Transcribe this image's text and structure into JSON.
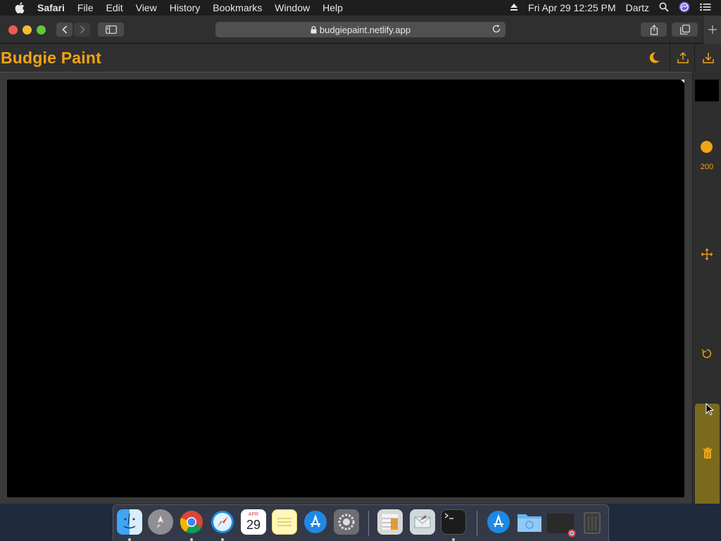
{
  "menubar": {
    "app_name": "Safari",
    "items": [
      "File",
      "Edit",
      "View",
      "History",
      "Bookmarks",
      "Window",
      "Help"
    ],
    "clock": "Fri Apr 29  12:25 PM",
    "user": "Dartz"
  },
  "browser": {
    "url": "budgiepaint.netlify.app"
  },
  "app": {
    "title": "Budgie Paint",
    "accent_color": "#f3a413",
    "brush_size": "200",
    "current_color": "#000000"
  },
  "dock": {
    "calendar_month": "APR",
    "calendar_day": "29",
    "apps": [
      "finder",
      "launchpad",
      "chrome",
      "safari",
      "calendar",
      "notes",
      "app-store",
      "system-preferences",
      "calculator",
      "mail",
      "terminal",
      "app-store-downloads",
      "folder",
      "chrome-window",
      "trash"
    ]
  }
}
